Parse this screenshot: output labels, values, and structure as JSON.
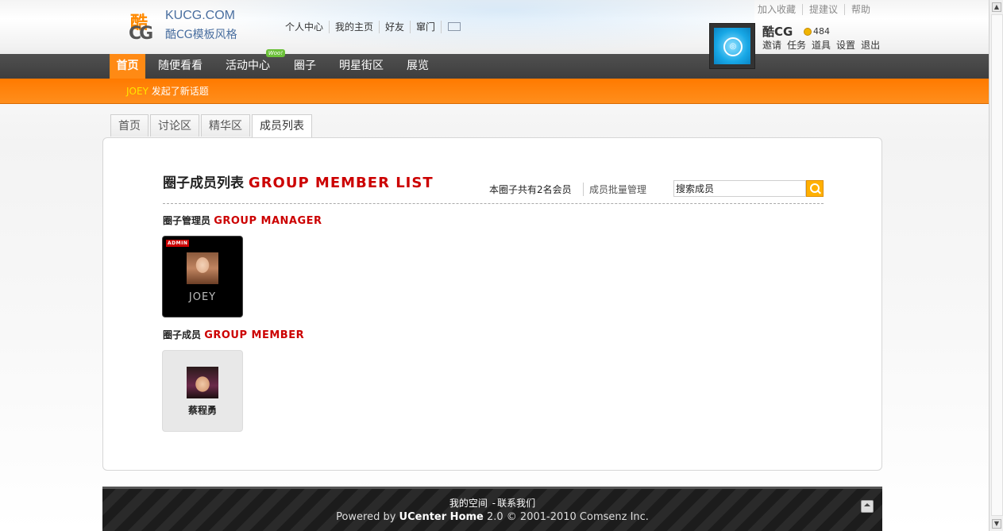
{
  "site": {
    "logo_text": "KUCG.COM",
    "logo_subtitle": "酷CG模板风格",
    "logo_mark_top": "酷",
    "logo_mark_bottom": "CG"
  },
  "top_nav": [
    "个人中心",
    "我的主页",
    "好友",
    "窜门"
  ],
  "top_links": [
    "加入收藏",
    "提建议",
    "帮助"
  ],
  "user": {
    "name": "酷CG",
    "credits": "484",
    "links": [
      "邀请",
      "任务",
      "道具",
      "设置",
      "退出"
    ]
  },
  "main_nav": [
    "首页",
    "随便看看",
    "活动中心",
    "圈子",
    "明星街区",
    "展览"
  ],
  "new_badge": "Woo!",
  "ticker": {
    "who": "JOEY",
    "action": " 发起了新话题"
  },
  "tabs": [
    "首页",
    "讨论区",
    "精华区",
    "成员列表"
  ],
  "panel": {
    "title_cn": "圈子成员列表",
    "title_en": "GROUP MEMBER LIST",
    "member_count": "本圈子共有2名会员",
    "batch_manage": "成员批量管理",
    "search_value": "搜索成员"
  },
  "sections": {
    "manager": {
      "cn": "圈子管理员",
      "en": "GROUP MANAGER"
    },
    "member": {
      "cn": "圈子成员",
      "en": "GROUP MEMBER"
    }
  },
  "managers": [
    {
      "name": "JOEY",
      "tag": "ADMIN"
    }
  ],
  "members": [
    {
      "name": "蔡程勇"
    }
  ],
  "footer": {
    "link1": "我的空间",
    "link2": "联系我们",
    "powered_prefix": "Powered by ",
    "product": "UCenter Home",
    "powered_suffix": " 2.0 © 2001-2010 Comsenz Inc."
  },
  "colors": {
    "accent_orange": "#ff8a14",
    "nav_dark": "#444444",
    "title_red": "#cc0000",
    "link_blue": "#4a6fa0"
  }
}
